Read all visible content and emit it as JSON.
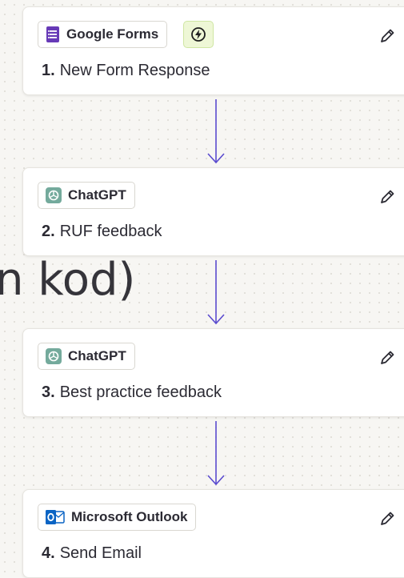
{
  "overlay_text": "n kod)",
  "steps": [
    {
      "app": "Google Forms",
      "number": "1.",
      "title": "New Form Response",
      "trigger_badge": "lightning-icon",
      "app_icon": "google-forms-icon"
    },
    {
      "app": "ChatGPT",
      "number": "2.",
      "title": "RUF feedback",
      "app_icon": "chatgpt-icon"
    },
    {
      "app": "ChatGPT",
      "number": "3.",
      "title": "Best practice feedback",
      "app_icon": "chatgpt-icon"
    },
    {
      "app": "Microsoft Outlook",
      "number": "4.",
      "title": "Send Email",
      "app_icon": "outlook-icon"
    }
  ],
  "colors": {
    "connector": "#5b4ccf",
    "google_forms": "#673ab7",
    "chatgpt": "#74aa9c",
    "outlook": "#0a64c4",
    "trigger_badge_bg": "#eef7d6"
  }
}
